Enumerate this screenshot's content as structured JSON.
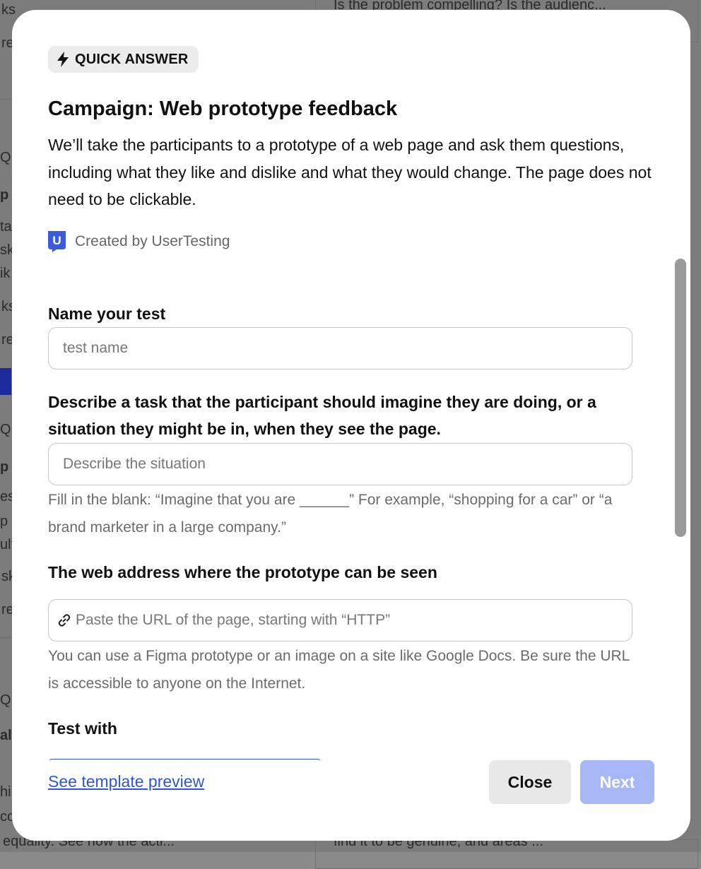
{
  "modal": {
    "badge_label": "QUICK ANSWER",
    "title": "Campaign: Web prototype feedback",
    "description": "We’ll take the participants to a prototype of a web page and ask them questions, including what they like and dislike and what they would change. The page does not need to be clickable.",
    "creator": "Created by UserTesting",
    "logo_letter": "U"
  },
  "form": {
    "name": {
      "label": "Name your test",
      "placeholder": "test name"
    },
    "situation": {
      "label": "Describe a task that the participant should imagine they are doing, or a situation they might be in, when they see the page.",
      "placeholder": "Describe the situation",
      "help": "Fill in the blank: “Imagine that you are ______” For example, “shopping for a car” or “a brand marketer in a large company.”"
    },
    "url": {
      "label": "The web address where the prototype can be seen",
      "placeholder": "Paste the URL of the page, starting with “HTTP”",
      "help": "You can use a Figma prototype or an image on a site like Google Docs. Be sure the URL is accessible to anyone on the Internet."
    },
    "test_with": {
      "label": "Test with"
    }
  },
  "footer": {
    "preview_link": "See template preview",
    "close_label": "Close",
    "next_label": "Next"
  },
  "background": {
    "right_top_snippet": "Is the problem compelling? Is the audienc...",
    "right_bottom_snippet": "find it to be genuine, and areas ...",
    "left_bottom_snippet": "equality. See how the acti..."
  },
  "colors": {
    "accent": "#2d55d6",
    "next_disabled": "#a7b6f5",
    "logo_blue": "#3b5bdb"
  }
}
